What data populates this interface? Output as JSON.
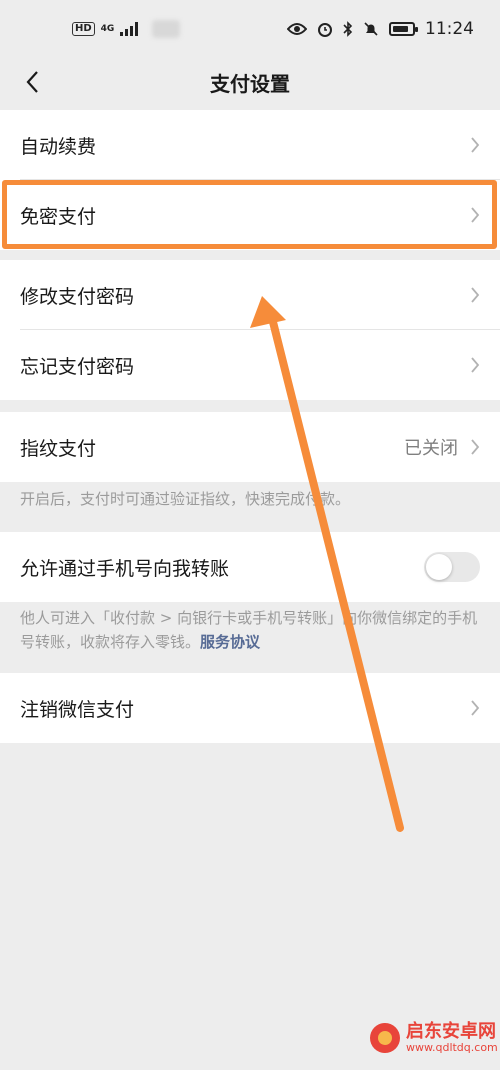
{
  "status_bar": {
    "hd_badge": "HD",
    "network": "4G",
    "time": "11:24",
    "icons": [
      "eye-icon",
      "alarm-icon",
      "bluetooth-icon",
      "mute-bell-icon",
      "battery-icon"
    ]
  },
  "nav": {
    "title": "支付设置",
    "back_icon": "chevron-left-icon"
  },
  "group1": {
    "items": [
      {
        "label": "自动续费"
      },
      {
        "label": "免密支付"
      }
    ]
  },
  "group2": {
    "items": [
      {
        "label": "修改支付密码"
      },
      {
        "label": "忘记支付密码"
      }
    ]
  },
  "fingerprint": {
    "label": "指纹支付",
    "value": "已关闭",
    "note": "开启后，支付时可通过验证指纹，快速完成付款。"
  },
  "phone_transfer": {
    "label": "允许通过手机号向我转账",
    "enabled": false,
    "note": "他人可进入「收付款 > 向银行卡或手机号转账」向你微信绑定的手机号转账，收款将存入零钱。",
    "link": "服务协议"
  },
  "cancel": {
    "label": "注销微信支付"
  },
  "colors": {
    "background": "#ededed",
    "highlight": "#f68c3a",
    "link": "#576b95"
  },
  "watermark": {
    "name": "启东安卓网",
    "url": "www.qdltdq.com"
  }
}
